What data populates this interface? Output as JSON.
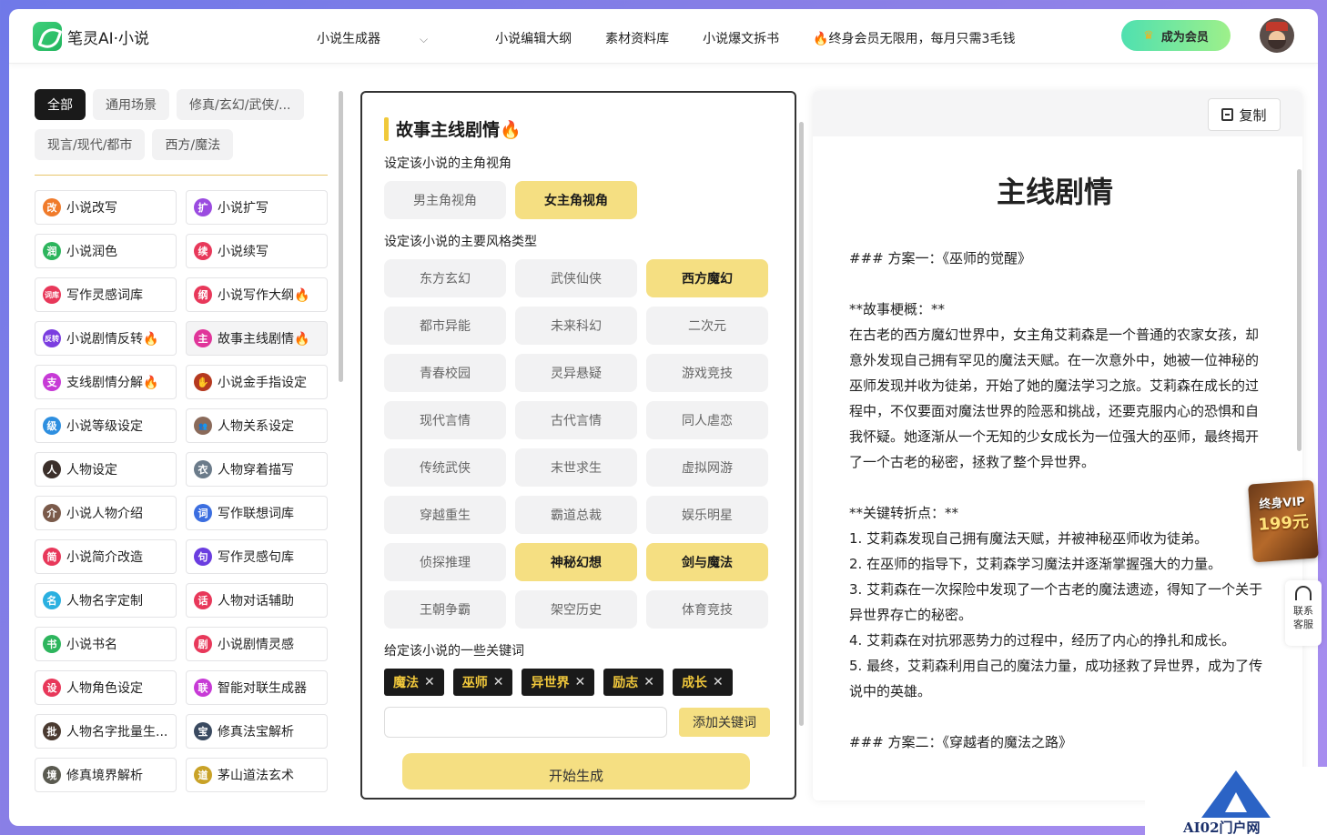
{
  "header": {
    "logo_text": "笔灵AI·小说",
    "nav": [
      "小说生成器",
      "小说编辑大纲",
      "素材资料库",
      "小说爆文拆书",
      "🔥终身会员无限用，每月只需3毛钱"
    ],
    "vip_button": "成为会员"
  },
  "filters": [
    "全部",
    "通用场景",
    "修真/玄幻/武侠/...",
    "现言/现代/都市",
    "西方/魔法"
  ],
  "tools": [
    {
      "label": "小说改写",
      "icon": "改",
      "color": "#f07b2b"
    },
    {
      "label": "小说扩写",
      "icon": "扩",
      "color": "#9b4be0"
    },
    {
      "label": "小说润色",
      "icon": "润",
      "color": "#2db55d"
    },
    {
      "label": "小说续写",
      "icon": "续",
      "color": "#e8385a"
    },
    {
      "label": "写作灵感词库",
      "icon": "词库",
      "color": "#e8385a"
    },
    {
      "label": "小说写作大纲🔥",
      "icon": "纲",
      "color": "#e8385a"
    },
    {
      "label": "小说剧情反转🔥",
      "icon": "反转",
      "color": "#7b3de0"
    },
    {
      "label": "故事主线剧情🔥",
      "icon": "主",
      "color": "#e0359a"
    },
    {
      "label": "支线剧情分解🔥",
      "icon": "支",
      "color": "#c73ad6"
    },
    {
      "label": "小说金手指设定",
      "icon": "✋",
      "color": "#b5391f"
    },
    {
      "label": "小说等级设定",
      "icon": "级",
      "color": "#2e8fe0"
    },
    {
      "label": "人物关系设定",
      "icon": "👥",
      "color": "#8a6a5a"
    },
    {
      "label": "人物设定",
      "icon": "人",
      "color": "#3b2f2a"
    },
    {
      "label": "人物穿着描写",
      "icon": "衣",
      "color": "#6b7b8a"
    },
    {
      "label": "小说人物介绍",
      "icon": "介",
      "color": "#7a5a4a"
    },
    {
      "label": "写作联想词库",
      "icon": "词",
      "color": "#3b6ee0"
    },
    {
      "label": "小说简介改造",
      "icon": "简",
      "color": "#e8385a"
    },
    {
      "label": "写作灵感句库",
      "icon": "句",
      "color": "#6b3de0"
    },
    {
      "label": "人物名字定制",
      "icon": "名",
      "color": "#2ab0e0"
    },
    {
      "label": "人物对话辅助",
      "icon": "话",
      "color": "#e8385a"
    },
    {
      "label": "小说书名",
      "icon": "书",
      "color": "#2db55d"
    },
    {
      "label": "小说剧情灵感",
      "icon": "剧",
      "color": "#e8385a"
    },
    {
      "label": "人物角色设定",
      "icon": "设",
      "color": "#e8385a"
    },
    {
      "label": "智能对联生成器",
      "icon": "联",
      "color": "#c73ad6"
    },
    {
      "label": "人物名字批量生...",
      "icon": "批",
      "color": "#4a3a30"
    },
    {
      "label": "修真法宝解析",
      "icon": "宝",
      "color": "#3a4a60"
    },
    {
      "label": "修真境界解析",
      "icon": "境",
      "color": "#5a5a50"
    },
    {
      "label": "茅山道法玄术",
      "icon": "道",
      "color": "#c9a227"
    }
  ],
  "form": {
    "title": "故事主线剧情🔥",
    "perspective_label": "设定该小说的主角视角",
    "perspectives": [
      "男主角视角",
      "女主角视角"
    ],
    "perspective_selected": [
      1
    ],
    "style_label": "设定该小说的主要风格类型",
    "styles": [
      "东方玄幻",
      "武侠仙侠",
      "西方魔幻",
      "都市异能",
      "未来科幻",
      "二次元",
      "青春校园",
      "灵异悬疑",
      "游戏竞技",
      "现代言情",
      "古代言情",
      "同人虐恋",
      "传统武侠",
      "末世求生",
      "虚拟网游",
      "穿越重生",
      "霸道总裁",
      "娱乐明星",
      "侦探推理",
      "神秘幻想",
      "剑与魔法",
      "王朝争霸",
      "架空历史",
      "体育竞技"
    ],
    "style_selected": [
      2,
      19,
      20
    ],
    "keyword_label": "给定该小说的一些关键词",
    "keywords": [
      "魔法",
      "巫师",
      "异世界",
      "励志",
      "成长"
    ],
    "keyword_input_value": "",
    "add_keyword_button": "添加关键词",
    "generate_button": "开始生成"
  },
  "output": {
    "copy_button": "复制",
    "title": "主线剧情",
    "lines": [
      "### 方案一：《巫师的觉醒》",
      "",
      "**故事梗概：**",
      "在古老的西方魔幻世界中，女主角艾莉森是一个普通的农家女孩，却意外发现自己拥有罕见的魔法天赋。在一次意外中，她被一位神秘的巫师发现并收为徒弟，开始了她的魔法学习之旅。艾莉森在成长的过程中，不仅要面对魔法世界的险恶和挑战，还要克服内心的恐惧和自我怀疑。她逐渐从一个无知的少女成长为一位强大的巫师，最终揭开了一个古老的秘密，拯救了整个异世界。",
      "",
      "**关键转折点：**",
      "1. 艾莉森发现自己拥有魔法天赋，并被神秘巫师收为徒弟。",
      "2. 在巫师的指导下，艾莉森学习魔法并逐渐掌握强大的力量。",
      "3. 艾莉森在一次探险中发现了一个古老的魔法遗迹，得知了一个关于异世界存亡的秘密。",
      "4. 艾莉森在对抗邪恶势力的过程中，经历了内心的挣扎和成长。",
      "5. 最终，艾莉森利用自己的魔法力量，成功拯救了异世界，成为了传说中的英雄。",
      "",
      "### 方案二：《穿越者的魔法之路》"
    ]
  },
  "promo": {
    "line1": "终身VIP",
    "line2": "199元"
  },
  "contact": {
    "line1": "联系",
    "line2": "客服"
  },
  "watermark": "AI02门户网"
}
